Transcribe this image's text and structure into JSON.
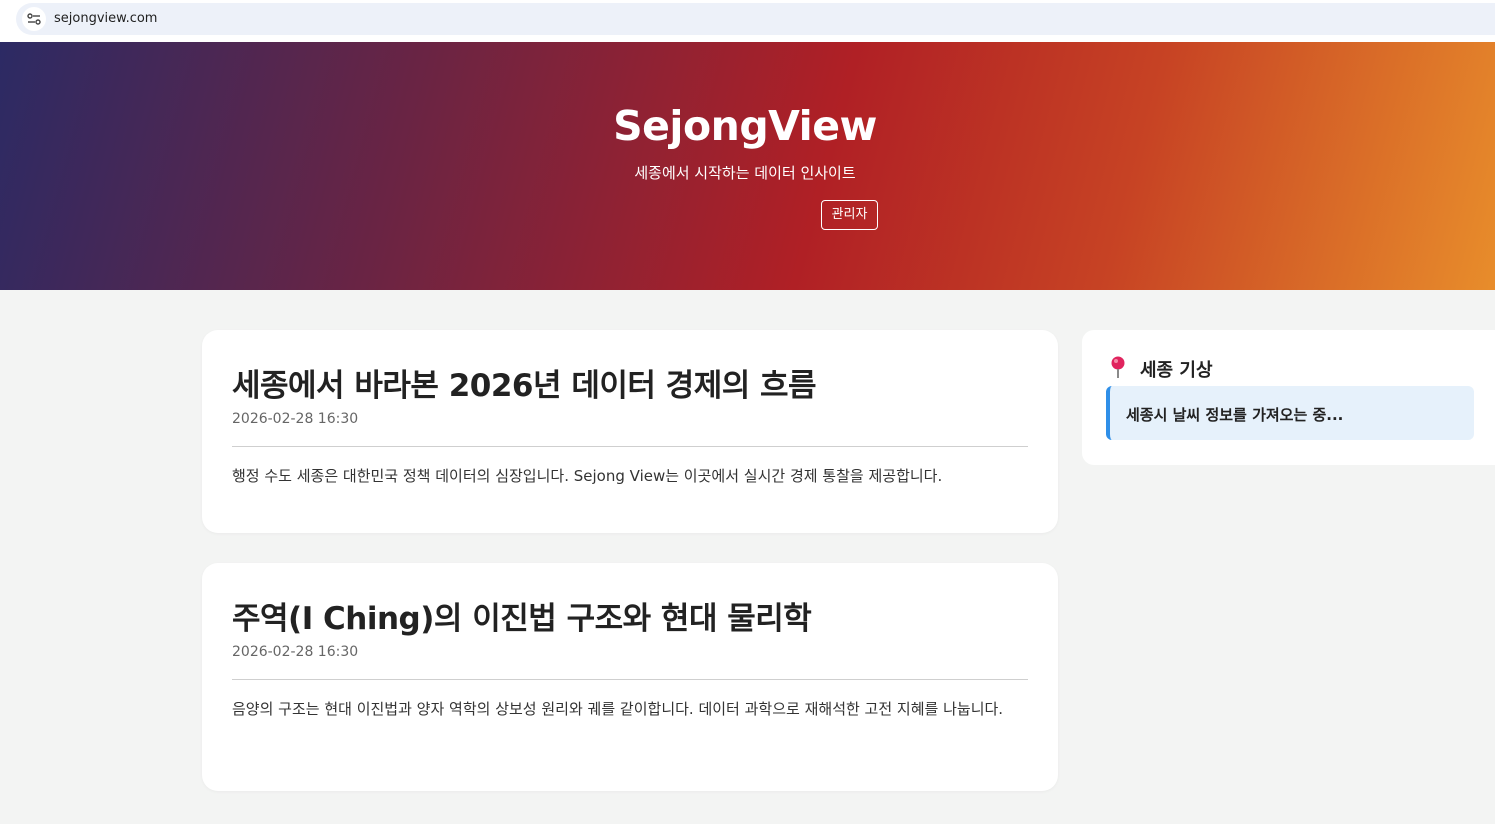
{
  "browser": {
    "url": "sejongview.com",
    "site_icon": "tune-icon"
  },
  "hero": {
    "title": "SejongView",
    "subtitle": "세종에서 시작하는 데이터 인사이트",
    "admin_label": "관리자",
    "gradient_colors": [
      "#2c2a64",
      "#b02025",
      "#e88d2b"
    ]
  },
  "posts": [
    {
      "title": "세종에서 바라본 2026년 데이터 경제의 흐름",
      "date": "2026-02-28 16:30",
      "excerpt": "행정 수도 세종은 대한민국 정책 데이터의 심장입니다. Sejong View는 이곳에서 실시간 경제 통찰을 제공합니다."
    },
    {
      "title": "주역(I Ching)의 이진법 구조와 현대 물리학",
      "date": "2026-02-28 16:30",
      "excerpt": "음양의 구조는 현대 이진법과 양자 역학의 상보성 원리와 궤를 같이합니다. 데이터 과학으로 재해석한 고전 지혜를 나눕니다."
    }
  ],
  "sidebar": {
    "weather_title": "세종 기상",
    "weather_icon": "pin-icon",
    "weather_status": "세종시 날씨 정보를 가져오는 중...",
    "accent_color": "#2f8fe8"
  }
}
